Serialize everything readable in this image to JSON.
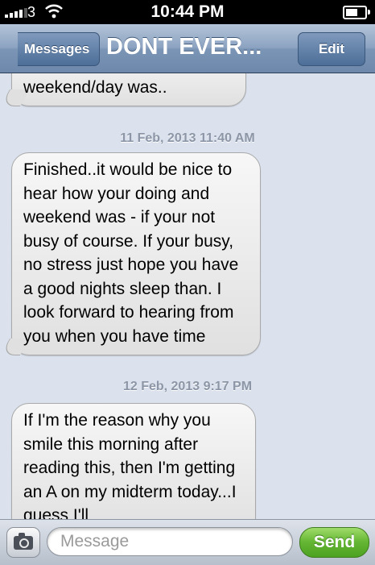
{
  "status_bar": {
    "carrier": "3",
    "time": "10:44 PM",
    "battery_level": 0.7,
    "icons": [
      "signal-icon",
      "wifi-icon",
      "battery-icon"
    ]
  },
  "nav": {
    "back_label": "Messages",
    "title": "DONT EVER...",
    "edit_label": "Edit"
  },
  "conversation": {
    "messages": [
      {
        "text": "texts to tell me how your weekend/day was.."
      },
      {
        "timestamp": "11 Feb, 2013 11:40 AM",
        "text": "Finished..it would be nice to hear how your doing and weekend was - if your not busy of course. If your busy, no stress just hope you have a good nights sleep than. I look forward to hearing from you when you have time"
      },
      {
        "timestamp": "12 Feb, 2013 9:17 PM",
        "text": "If I'm the reason why you smile this morning after reading this, then I'm getting an A on my midterm today...I guess I'll"
      }
    ]
  },
  "input_bar": {
    "placeholder": "Message",
    "send_label": "Send",
    "camera_icon": "camera-icon"
  },
  "colors": {
    "background": "#dbe2ed",
    "send_green": "#63b532",
    "nav_blue": "#6d88ab"
  }
}
